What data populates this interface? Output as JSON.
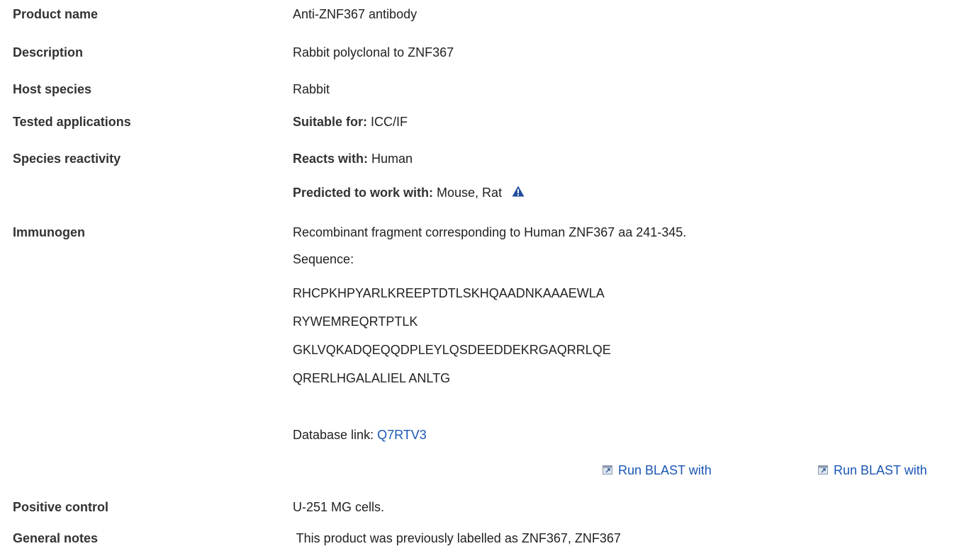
{
  "rows": {
    "product_name": {
      "label": "Product name",
      "value": "Anti-ZNF367 antibody"
    },
    "description": {
      "label": "Description",
      "value": "Rabbit polyclonal to ZNF367"
    },
    "host_species": {
      "label": "Host species",
      "value": "Rabbit"
    },
    "tested_applications": {
      "label": "Tested applications",
      "prefix": "Suitable for:",
      "value": " ICC/IF"
    },
    "species_reactivity": {
      "label": "Species reactivity",
      "reacts_prefix": "Reacts with:",
      "reacts_value": " Human",
      "predicted_prefix": "Predicted to work with:",
      "predicted_value": " Mouse, Rat",
      "warning_icon": "warning-triangle-icon"
    },
    "immunogen": {
      "label": "Immunogen",
      "text": "Recombinant fragment corresponding to Human ZNF367 aa 241-345.",
      "sequence_label": "Sequence:",
      "sequence_lines": [
        "RHCPKHPYARLKREEPTDTLSKHQAADNKAAAEWLA",
        "RYWEMREQRTPTLK",
        "GKLVQKADQEQQDPLEYLQSDEEDDEKRGAQRRLQE",
        "QRERLHGALALIEL ANLTG"
      ],
      "database_prefix": "Database link: ",
      "database_link": "Q7RTV3",
      "blast_links": [
        "Run BLAST with",
        "Run BLAST with"
      ],
      "blast_icon": "external-link-icon"
    },
    "positive_control": {
      "label": "Positive control",
      "value": "U-251 MG cells."
    },
    "general_notes": {
      "label": "General notes",
      "value": " This product was previously labelled as ZNF367, ZNF367"
    }
  },
  "colors": {
    "link": "#1a56b5",
    "warning": "#1f4e9c",
    "label": "#333333"
  }
}
